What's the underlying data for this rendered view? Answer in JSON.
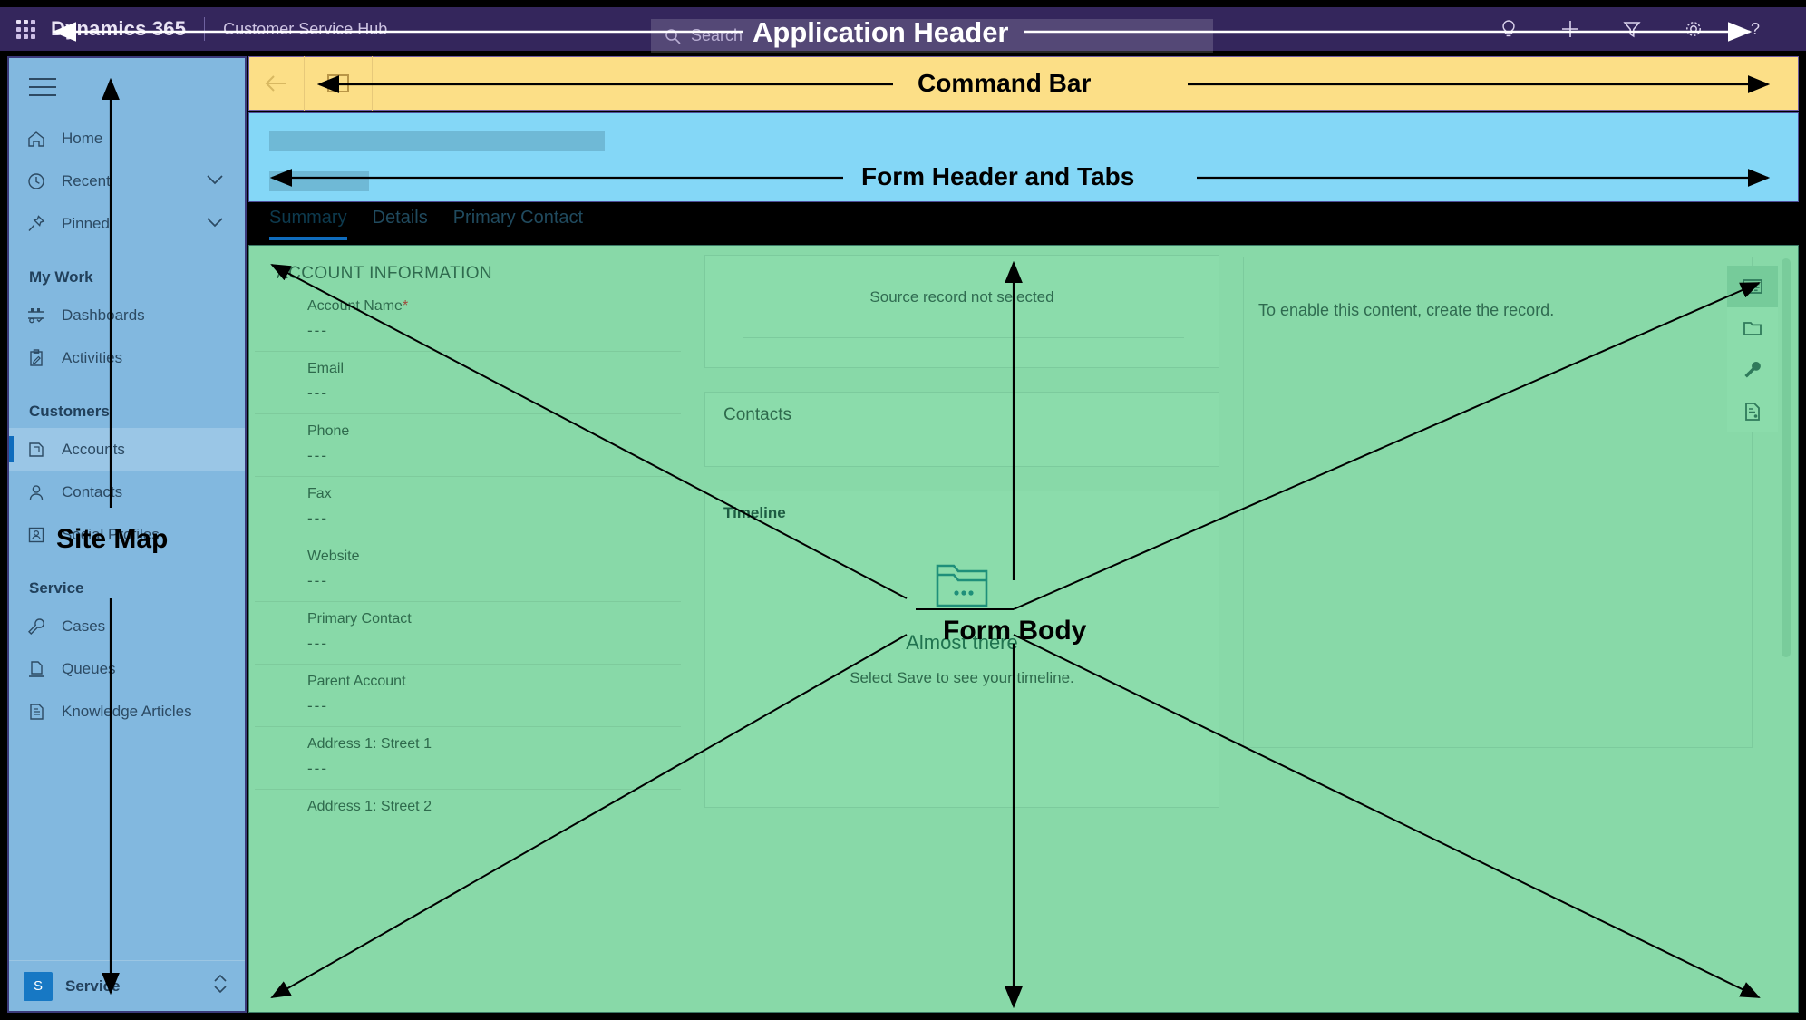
{
  "app_header": {
    "waffle_icon": "waffle-icon",
    "brand": "Dynamics 365",
    "app_name": "Customer Service Hub",
    "search_placeholder": "Search",
    "search_icon": "search-icon",
    "icons": [
      {
        "name": "lightbulb-icon",
        "glyph": "insights"
      },
      {
        "name": "plus-icon",
        "glyph": "new"
      },
      {
        "name": "filter-icon",
        "glyph": "filter"
      },
      {
        "name": "gear-icon",
        "glyph": "settings"
      },
      {
        "name": "question-icon",
        "glyph": "help"
      }
    ]
  },
  "sidebar": {
    "hamburger_icon": "hamburger-icon",
    "items": [
      {
        "label": "Home",
        "icon": "home-icon",
        "chevron": false,
        "selected": false
      },
      {
        "label": "Recent",
        "icon": "clock-icon",
        "chevron": true,
        "selected": false
      },
      {
        "label": "Pinned",
        "icon": "pin-icon",
        "chevron": true,
        "selected": false
      }
    ],
    "group_my_work": "My Work",
    "my_work": [
      {
        "label": "Dashboards",
        "icon": "dashboards-icon",
        "selected": false
      },
      {
        "label": "Activities",
        "icon": "activities-icon",
        "selected": false
      }
    ],
    "group_customers": "Customers",
    "customers": [
      {
        "label": "Accounts",
        "icon": "accounts-icon",
        "selected": true
      },
      {
        "label": "Contacts",
        "icon": "contact-icon",
        "selected": false
      },
      {
        "label": "Social Profiles",
        "icon": "social-profile-icon",
        "selected": false
      }
    ],
    "group_service": "Service",
    "service": [
      {
        "label": "Cases",
        "icon": "wrench-icon",
        "selected": false
      },
      {
        "label": "Queues",
        "icon": "queues-icon",
        "selected": false
      },
      {
        "label": "Knowledge Articles",
        "icon": "article-icon",
        "selected": false
      }
    ],
    "profile": {
      "initial": "S",
      "name": "Service",
      "switcher_icon": "up-down-chevron-icon"
    }
  },
  "command_bar": {
    "back_icon": "back-arrow-icon",
    "new_icon": "new-record-icon"
  },
  "form_header": {
    "placeholder_title": "",
    "placeholder_subtitle": "",
    "tabs": [
      {
        "label": "Summary",
        "active": true
      },
      {
        "label": "Details",
        "active": false
      },
      {
        "label": "Primary Contact",
        "active": false
      }
    ]
  },
  "form_body": {
    "section_title": "ACCOUNT INFORMATION",
    "fields": [
      {
        "label": "Account Name",
        "required": true,
        "value": "---"
      },
      {
        "label": "Email",
        "required": false,
        "value": "---"
      },
      {
        "label": "Phone",
        "required": false,
        "value": "---"
      },
      {
        "label": "Fax",
        "required": false,
        "value": "---"
      },
      {
        "label": "Website",
        "required": false,
        "value": "---"
      },
      {
        "label": "Primary Contact",
        "required": false,
        "value": "---"
      },
      {
        "label": "Parent Account",
        "required": false,
        "value": "---"
      },
      {
        "label": "Address 1: Street 1",
        "required": false,
        "value": "---"
      },
      {
        "label": "Address 1: Street 2",
        "required": false,
        "value": ""
      }
    ],
    "source_record_text": "Source record not selected",
    "contacts_card_title": "Contacts",
    "timeline_card_title": "Timeline",
    "timeline_empty": {
      "icon": "folder-ellipsis-icon",
      "title": "Almost there",
      "subtitle": "Select Save to see your timeline."
    },
    "right_panel_text": "To enable this content, create the record.",
    "rail": [
      {
        "name": "contact-card-icon",
        "selected": true
      },
      {
        "name": "folder-icon",
        "selected": false
      },
      {
        "name": "wrench-icon",
        "selected": false
      },
      {
        "name": "document-icon",
        "selected": false
      }
    ],
    "scrollbar": "vertical-scrollbar"
  },
  "annotations": [
    {
      "id": "application-header",
      "text": "Application Header"
    },
    {
      "id": "command-bar",
      "text": "Command Bar"
    },
    {
      "id": "form-header-and-tabs",
      "text": "Form Header and Tabs"
    },
    {
      "id": "site-map",
      "text": "Site Map"
    },
    {
      "id": "form-body",
      "text": "Form Body"
    }
  ],
  "colors": {
    "header_purple": "#34265c",
    "sidemap_blue": "#82b8df",
    "command_yellow": "#fcdf87",
    "form_header_cyan": "#84d7f7",
    "form_body_green": "#88d9a8",
    "accent_blue": "#0f6cbd"
  }
}
